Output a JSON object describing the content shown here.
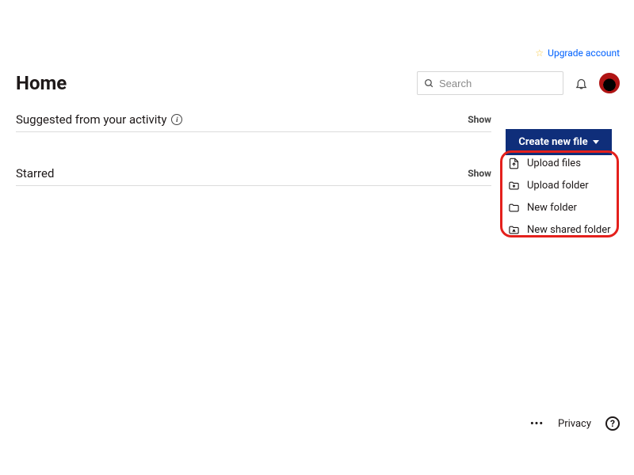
{
  "upgrade": {
    "label": "Upgrade account"
  },
  "page": {
    "title": "Home"
  },
  "search": {
    "placeholder": "Search"
  },
  "sections": {
    "suggested": {
      "title": "Suggested from your activity",
      "action": "Show"
    },
    "starred": {
      "title": "Starred",
      "action": "Show"
    }
  },
  "create_button": {
    "label": "Create new file"
  },
  "menu": {
    "upload_files": "Upload files",
    "upload_folder": "Upload folder",
    "new_folder": "New folder",
    "new_shared_folder": "New shared folder"
  },
  "footer": {
    "privacy": "Privacy"
  }
}
